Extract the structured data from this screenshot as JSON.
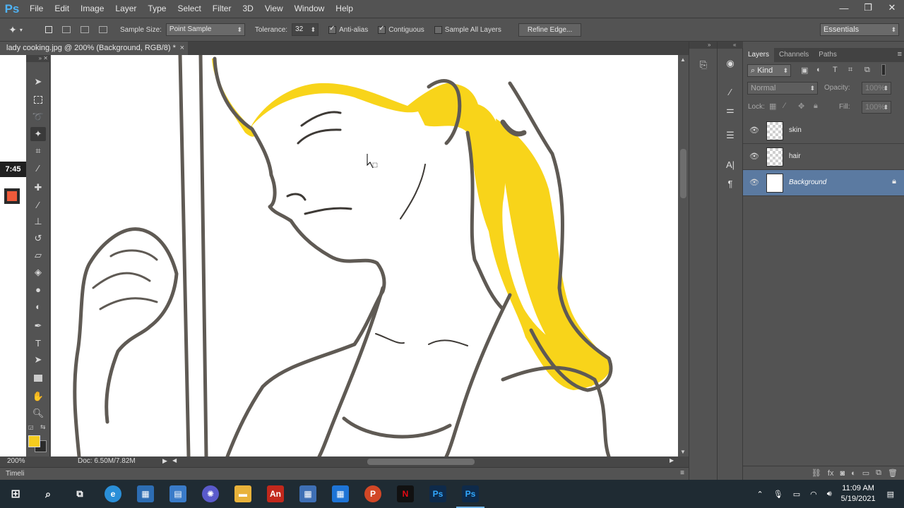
{
  "app": {
    "logo": "Ps",
    "menu": [
      "File",
      "Edit",
      "Image",
      "Layer",
      "Type",
      "Select",
      "Filter",
      "3D",
      "View",
      "Window",
      "Help"
    ],
    "window_controls": [
      "—",
      "❐",
      "✕"
    ]
  },
  "options_bar": {
    "sample_size_label": "Sample Size:",
    "sample_size_value": "Point Sample",
    "tolerance_label": "Tolerance:",
    "tolerance_value": "32",
    "anti_alias_label": "Anti-alias",
    "anti_alias_checked": true,
    "contiguous_label": "Contiguous",
    "contiguous_checked": true,
    "sample_all_layers_label": "Sample All Layers",
    "sample_all_layers_checked": false,
    "refine_edge_label": "Refine Edge...",
    "workspace_value": "Essentials"
  },
  "document": {
    "tab_title": "lady cooking.jpg @ 200% (Background, RGB/8) *",
    "close_glyph": "×",
    "zoom": "200%",
    "doc_info": "Doc: 6.50M/7.82M",
    "timeline_label": "Timeli"
  },
  "overlay": {
    "time_badge": "7:45",
    "rec_color": "#ef5a3a"
  },
  "colors": {
    "foreground": "#f5cc1e",
    "background": "#2b2b2b",
    "hair_fill": "#f8d41a",
    "line_art": "#5f5a54",
    "selected_layer": "#5b7aa1"
  },
  "layers_panel": {
    "tabs": [
      "Layers",
      "Channels",
      "Paths"
    ],
    "active_tab": "Layers",
    "filter_value": "Kind",
    "blend_mode": "Normal",
    "opacity_label": "Opacity:",
    "opacity_value": "100%",
    "lock_label": "Lock:",
    "fill_label": "Fill:",
    "fill_value": "100%",
    "layers": [
      {
        "name": "skin",
        "visible": true,
        "selected": false,
        "locked": false
      },
      {
        "name": "hair",
        "visible": true,
        "selected": false,
        "locked": false
      },
      {
        "name": "Background",
        "visible": true,
        "selected": true,
        "locked": true
      }
    ]
  },
  "taskbar": {
    "time": "11:09 AM",
    "date": "5/19/2021",
    "apps": [
      "windows-start",
      "search",
      "task-view",
      "edge",
      "store",
      "explorer-alt",
      "gear-app",
      "file-explorer",
      "acrobat",
      "calculator",
      "calendar",
      "powerpoint",
      "netflix",
      "photoshop",
      "photoshop-active"
    ]
  }
}
